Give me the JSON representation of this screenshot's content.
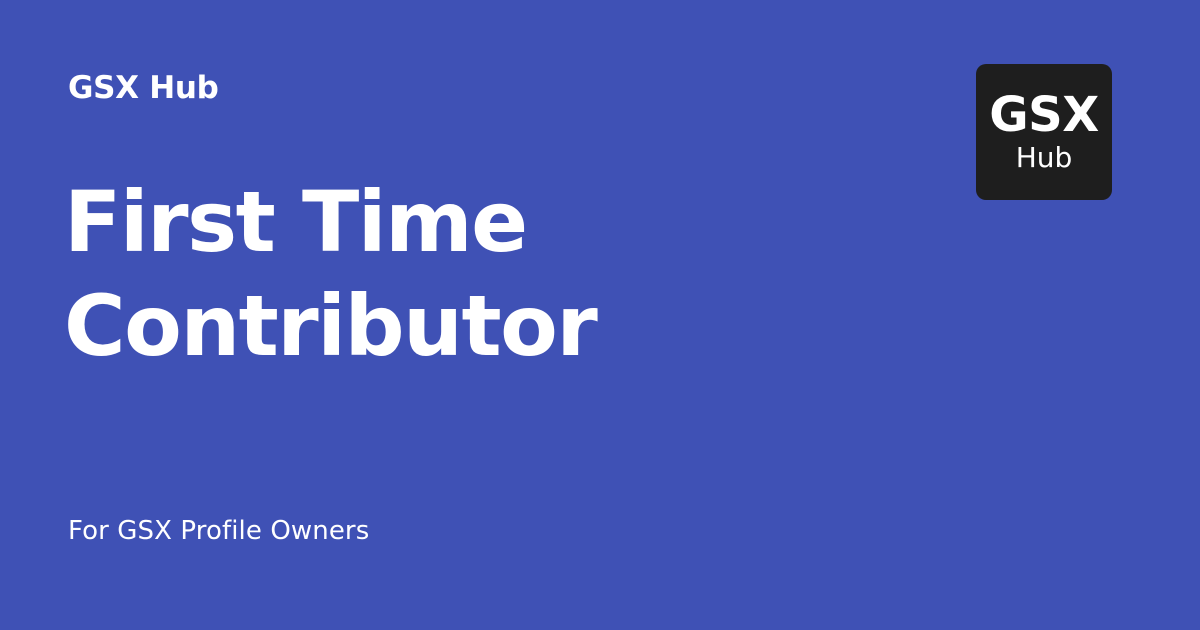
{
  "header": {
    "brand_label": "GSX Hub"
  },
  "main": {
    "title_line_1": "First Time",
    "title_line_2": "Contributor",
    "subtitle": "For GSX Profile Owners"
  },
  "logo": {
    "main_text": "GSX",
    "sub_text": "Hub",
    "background_color": "#1e1e1e"
  },
  "theme": {
    "background_color": "#3f51b5",
    "text_color": "#ffffff"
  }
}
